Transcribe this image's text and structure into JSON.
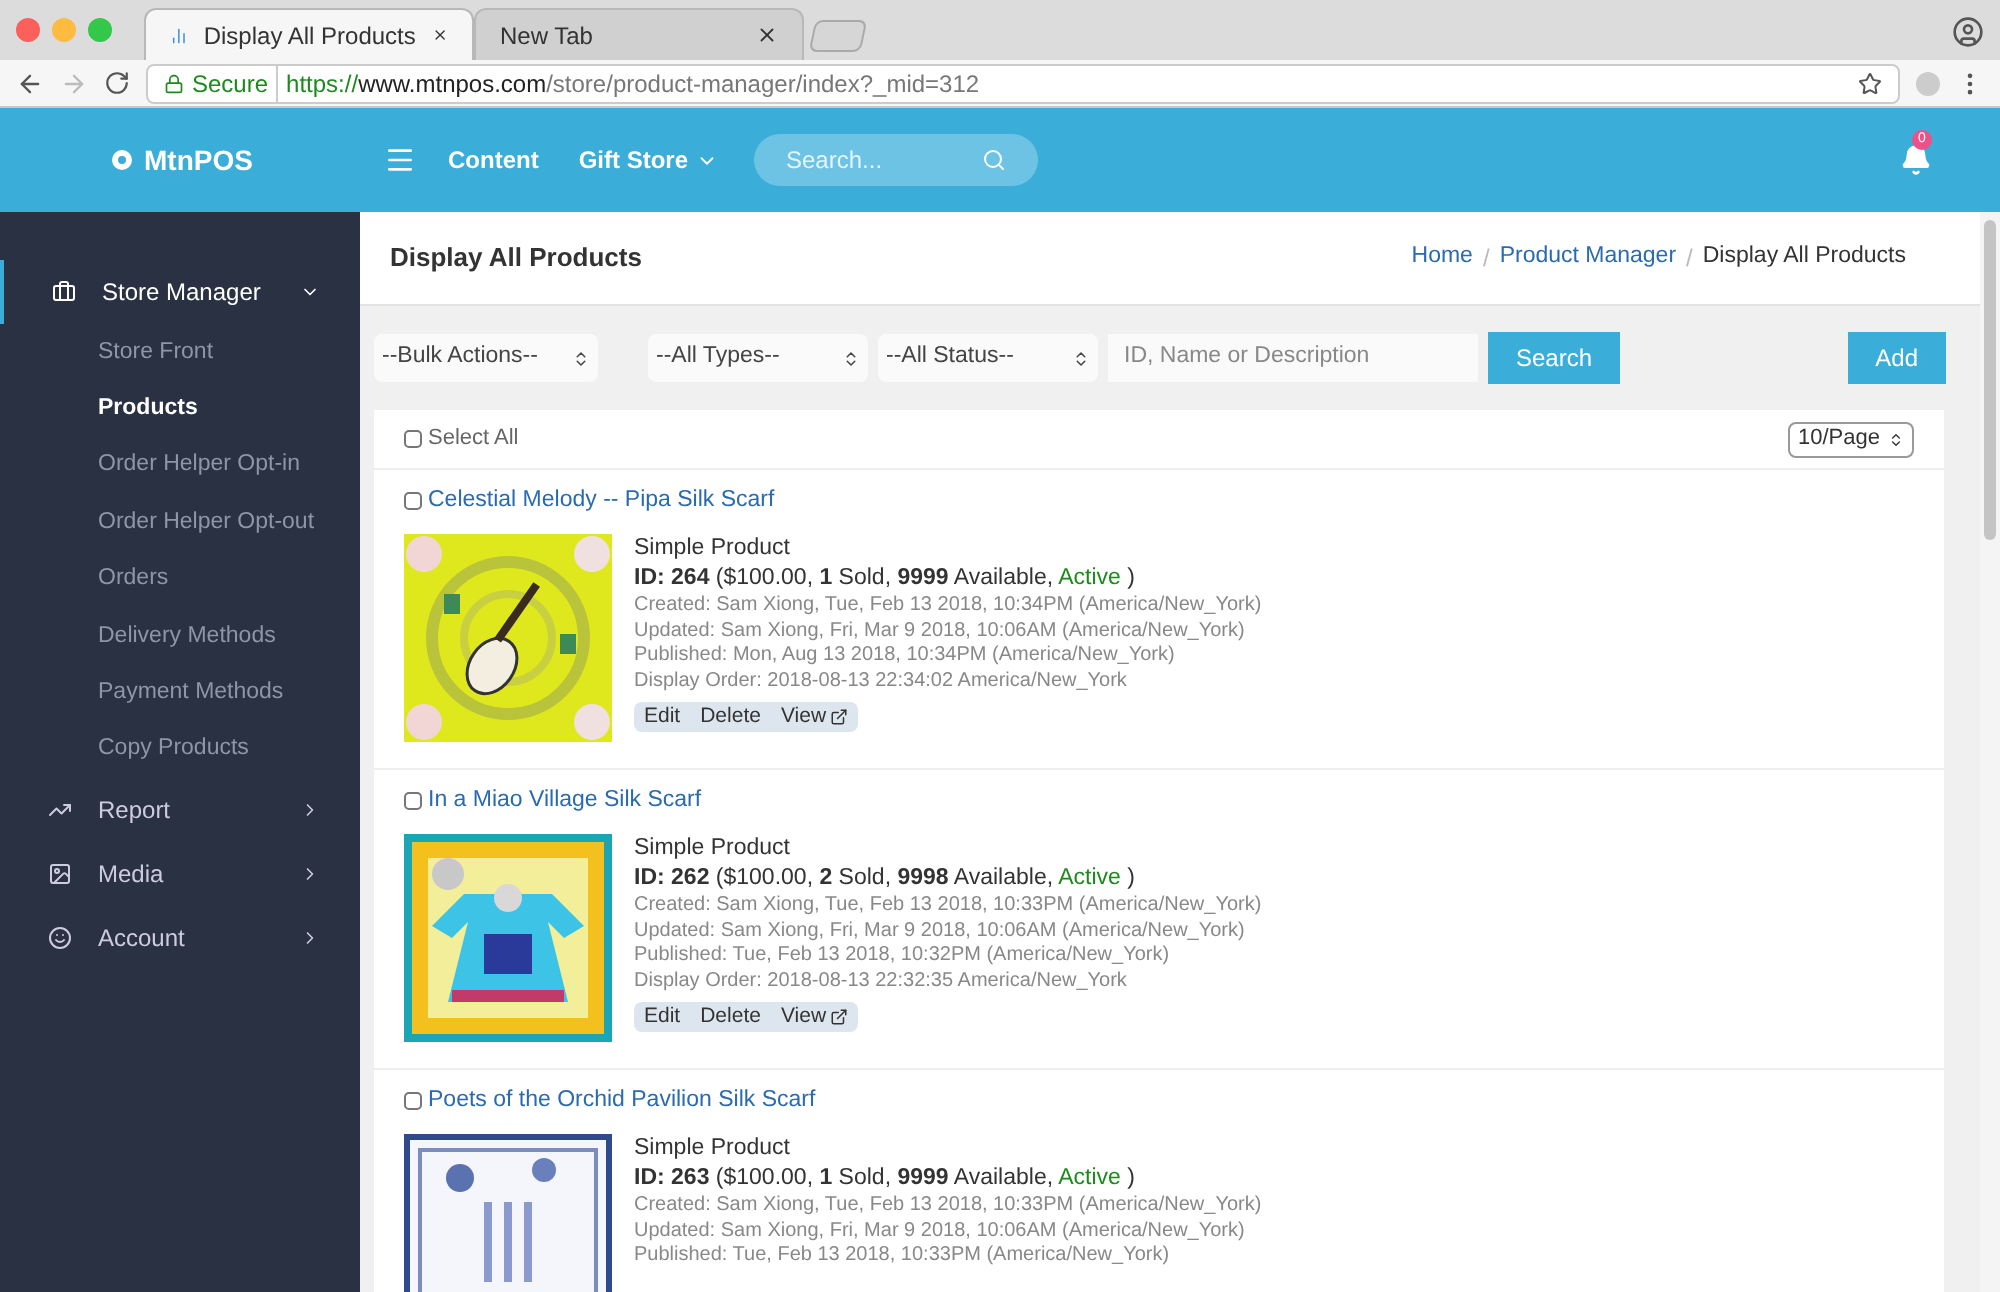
{
  "browser": {
    "tabs": [
      {
        "title": "Display All Products",
        "selected": true
      },
      {
        "title": "New Tab",
        "selected": false
      }
    ],
    "secure_label": "Secure",
    "url_scheme": "https://",
    "url_host": "www.mtnpos.com",
    "url_path": "/store/product-manager/index?_mid=312"
  },
  "header": {
    "brand": "MtnPOS",
    "nav": [
      {
        "label": "Content",
        "kind": "link"
      },
      {
        "label": "Gift Store",
        "kind": "dropdown"
      }
    ],
    "search": {
      "placeholder": "Search..."
    },
    "notifications": "0"
  },
  "sidebar": {
    "items": [
      {
        "label": "Store Manager",
        "expanded": true,
        "children": [
          {
            "label": "Store Front",
            "selected": false
          },
          {
            "label": "Products",
            "selected": true
          },
          {
            "label": "Order Helper Opt-in",
            "selected": false
          },
          {
            "label": "Order Helper Opt-out",
            "selected": false
          },
          {
            "label": "Orders",
            "selected": false
          },
          {
            "label": "Delivery Methods",
            "selected": false
          },
          {
            "label": "Payment Methods",
            "selected": false
          },
          {
            "label": "Copy Products",
            "selected": false
          }
        ]
      },
      {
        "label": "Report",
        "expanded": false
      },
      {
        "label": "Media",
        "expanded": false
      },
      {
        "label": "Account",
        "expanded": false
      }
    ]
  },
  "page": {
    "title": "Display All Products",
    "breadcrumb_separator": "/",
    "breadcrumb": [
      {
        "label": "Home",
        "kind": "link"
      },
      {
        "label": "Product Manager",
        "kind": "link"
      },
      {
        "label": "Display All Products",
        "kind": "current"
      }
    ]
  },
  "toolbar": {
    "selects": [
      "--Bulk Actions--",
      "--All Types--",
      "--All Status--"
    ],
    "search": {
      "placeholder": "ID, Name or Description"
    },
    "search_button": "Search",
    "add_button": "Add"
  },
  "list": {
    "select_all": {
      "label": "Select All",
      "checked": false
    },
    "page_size": "10/Page",
    "products": [
      {
        "name": "Celestial Melody -- Pipa Silk Scarf",
        "checked": false,
        "kind": "picture",
        "type": "Simple Product",
        "summary": "**ID: 264** ($100.00, **1** Sold, **9999** Available, ",
        "status": {
          "label": "Active",
          "color": "#1e8a1e"
        },
        "summary_end": ")",
        "meta": [
          "Created: Sam Xiong, Tue, Feb 13 2018, 10:34PM (America/New_York)",
          "Updated: Sam Xiong, Fri, Mar 9 2018, 10:06AM (America/New_York)",
          "Published: Mon, Aug 13 2018, 10:34PM (America/New_York)",
          "Display Order: 2018-08-13 22:34:02 America/New_York"
        ],
        "actions": [
          "Edit",
          "Delete",
          "View"
        ]
      },
      {
        "name": "In a Miao Village Silk Scarf",
        "checked": false,
        "kind": "picture",
        "type": "Simple Product",
        "summary": "**ID: 262** ($100.00, **2** Sold, **9998** Available, ",
        "status": {
          "label": "Active",
          "color": "#1e8a1e"
        },
        "summary_end": ")",
        "meta": [
          "Created: Sam Xiong, Tue, Feb 13 2018, 10:33PM (America/New_York)",
          "Updated: Sam Xiong, Fri, Mar 9 2018, 10:06AM (America/New_York)",
          "Published: Tue, Feb 13 2018, 10:32PM (America/New_York)",
          "Display Order: 2018-08-13 22:32:35 America/New_York"
        ],
        "actions": [
          "Edit",
          "Delete",
          "View"
        ]
      },
      {
        "name": "Poets of the Orchid Pavilion Silk Scarf",
        "checked": false,
        "kind": "picture",
        "type": "Simple Product",
        "summary": "**ID: 263** ($100.00, **1** Sold, **9999** Available, ",
        "status": {
          "label": "Active",
          "color": "#1e8a1e"
        },
        "summary_end": ")",
        "meta": [
          "Created: Sam Xiong, Tue, Feb 13 2018, 10:33PM (America/New_York)",
          "Updated: Sam Xiong, Fri, Mar 9 2018, 10:06AM (America/New_York)",
          "Published: Tue, Feb 13 2018, 10:33PM (America/New_York)"
        ]
      }
    ]
  }
}
